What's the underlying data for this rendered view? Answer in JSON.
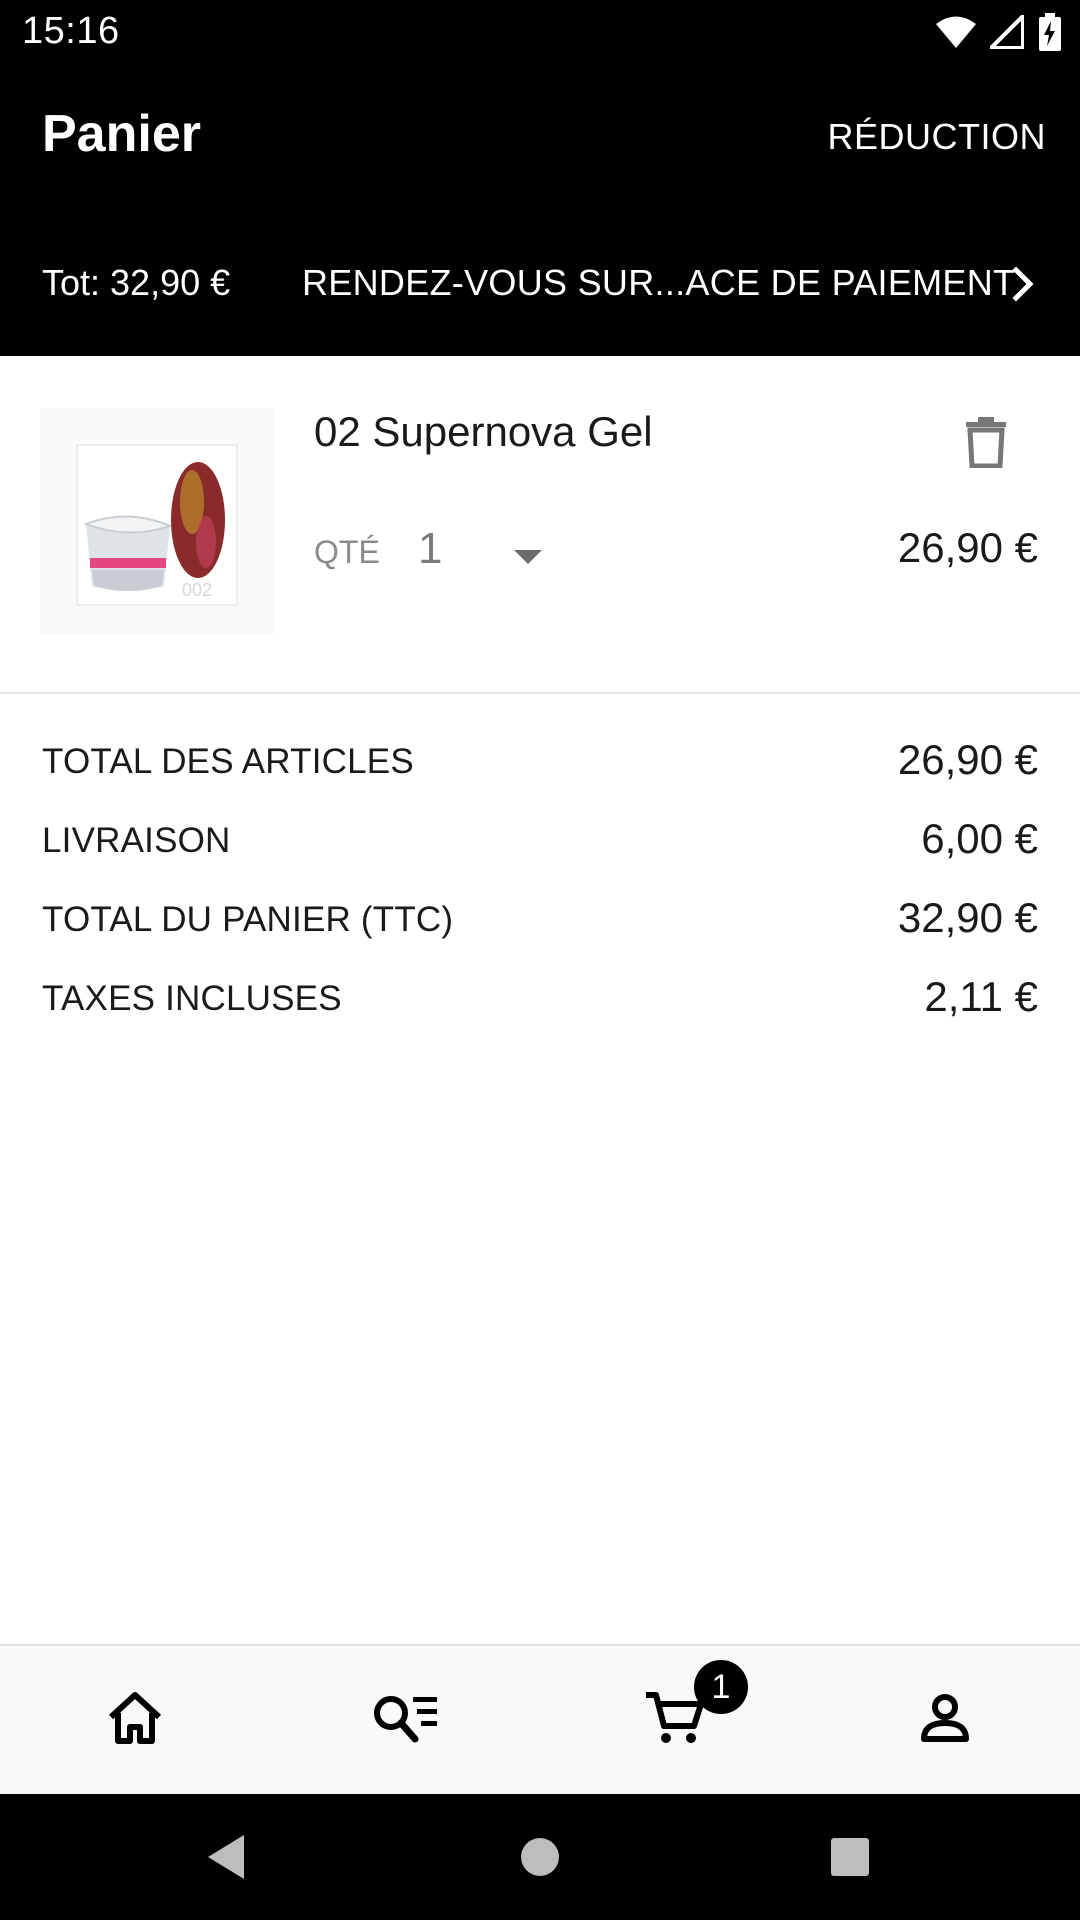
{
  "status_bar": {
    "time": "15:16",
    "icons": [
      "wifi-icon",
      "signal-icon",
      "battery-charging-icon"
    ]
  },
  "header": {
    "title": "Panier",
    "reduction_label": "RÉDUCTION",
    "total_label": "Tot: 32,90 €",
    "checkout_label": "RENDEZ-VOUS SUR...ACE DE PAIEMENT"
  },
  "cart": {
    "items": [
      {
        "name": "02 Supernova Gel",
        "qty_label": "QTÉ",
        "qty": "1",
        "price": "26,90 €",
        "image_caption": "002"
      }
    ]
  },
  "totals": [
    {
      "label": "TOTAL DES ARTICLES",
      "value": "26,90 €"
    },
    {
      "label": "LIVRAISON",
      "value": "6,00 €"
    },
    {
      "label": "TOTAL DU PANIER (TTC)",
      "value": "32,90 €"
    },
    {
      "label": "TAXES INCLUSES",
      "value": "2,11 €"
    }
  ],
  "bottom_nav": {
    "items": [
      "home-icon",
      "search-list-icon",
      "cart-icon",
      "account-icon"
    ],
    "cart_badge": "1"
  },
  "system_nav": [
    "back-icon",
    "home-circle-icon",
    "recents-icon"
  ],
  "colors": {
    "header_bg": "#000000",
    "accent": "#000000",
    "muted_text": "#8a8a8a"
  }
}
